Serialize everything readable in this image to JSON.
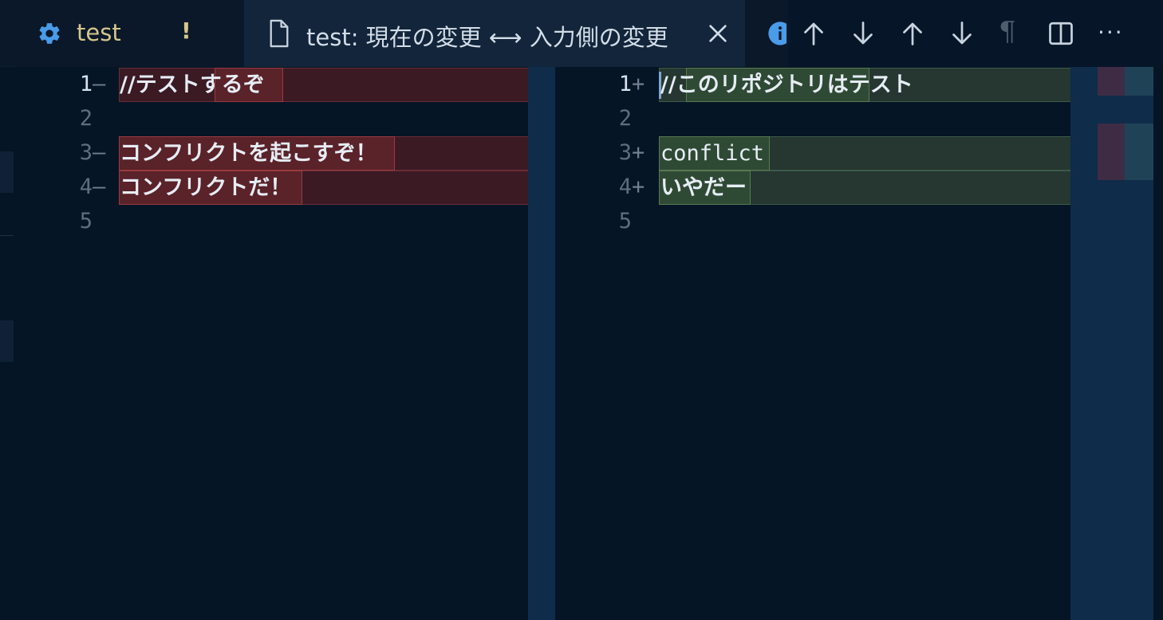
{
  "tabs": [
    {
      "label": "test",
      "badge": "!",
      "icon": "gear-icon"
    },
    {
      "label": "test: 現在の変更 ⟷ 入力側の変更",
      "icon": "file-icon",
      "close_icon": "close-icon"
    },
    {
      "icon": "info-icon"
    }
  ],
  "toolbar": {
    "actions": [
      "arrow-up-icon",
      "arrow-down-icon",
      "arrow-up-icon",
      "arrow-down-icon",
      "pilcrow-icon",
      "split-editor-icon",
      "more-icon"
    ],
    "pilcrow": "¶",
    "more": "···"
  },
  "left_pane": {
    "lines": [
      {
        "number": "1",
        "marker": "—",
        "text": "//テストするぞ"
      },
      {
        "number": "2",
        "marker": "",
        "text": ""
      },
      {
        "number": "3",
        "marker": "—",
        "text": "コンフリクトを起こすぞ！"
      },
      {
        "number": "4",
        "marker": "—",
        "text": "コンフリクトだ！"
      },
      {
        "number": "5",
        "marker": "",
        "text": ""
      }
    ]
  },
  "right_pane": {
    "lines": [
      {
        "number": "1",
        "marker": "+",
        "text": "//このリポジトリはテスト"
      },
      {
        "number": "2",
        "marker": "",
        "text": ""
      },
      {
        "number": "3",
        "marker": "+",
        "text": "conflict"
      },
      {
        "number": "4",
        "marker": "+",
        "text": "いやだー"
      },
      {
        "number": "5",
        "marker": "",
        "text": ""
      }
    ]
  },
  "colors": {
    "background": "#051526",
    "deleted": "#5a2229",
    "inserted": "#2f4a34",
    "modified_tab": "#d6c68c",
    "gear": "#4a9be8"
  }
}
